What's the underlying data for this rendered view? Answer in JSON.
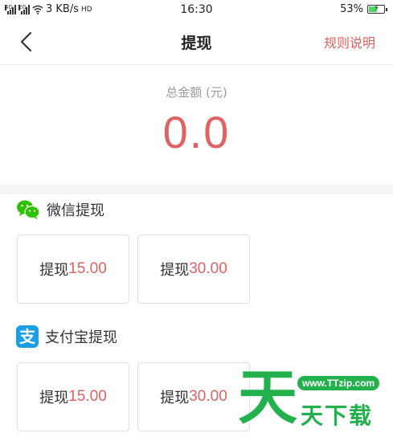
{
  "status_bar": {
    "net_speed": "3 KB/s",
    "time": "16:30",
    "battery_percent": "53%",
    "battery_level": 0.53,
    "network_tag_1": "4G",
    "network_tag_2": "2G",
    "hd_label": "HD"
  },
  "nav": {
    "title": "提现",
    "rules_label": "规则说明"
  },
  "balance": {
    "label": "总金额 (元)",
    "amount": "0.0"
  },
  "wechat": {
    "title": "微信提现",
    "options": [
      {
        "prefix": "提现",
        "amount": "15.00"
      },
      {
        "prefix": "提现",
        "amount": "30.00"
      }
    ]
  },
  "alipay": {
    "title": "支付宝提现",
    "icon_char": "支",
    "options": [
      {
        "prefix": "提现",
        "amount": "15.00"
      },
      {
        "prefix": "提现",
        "amount": "30.00"
      }
    ]
  },
  "watermark": {
    "big_char": "天",
    "url": "www.TTzip.com",
    "text": "天下载"
  },
  "colors": {
    "accent_red": "#e06262",
    "wechat_green": "#2dc100",
    "alipay_blue": "#1a9ee6",
    "watermark_green": "#22b14c"
  }
}
